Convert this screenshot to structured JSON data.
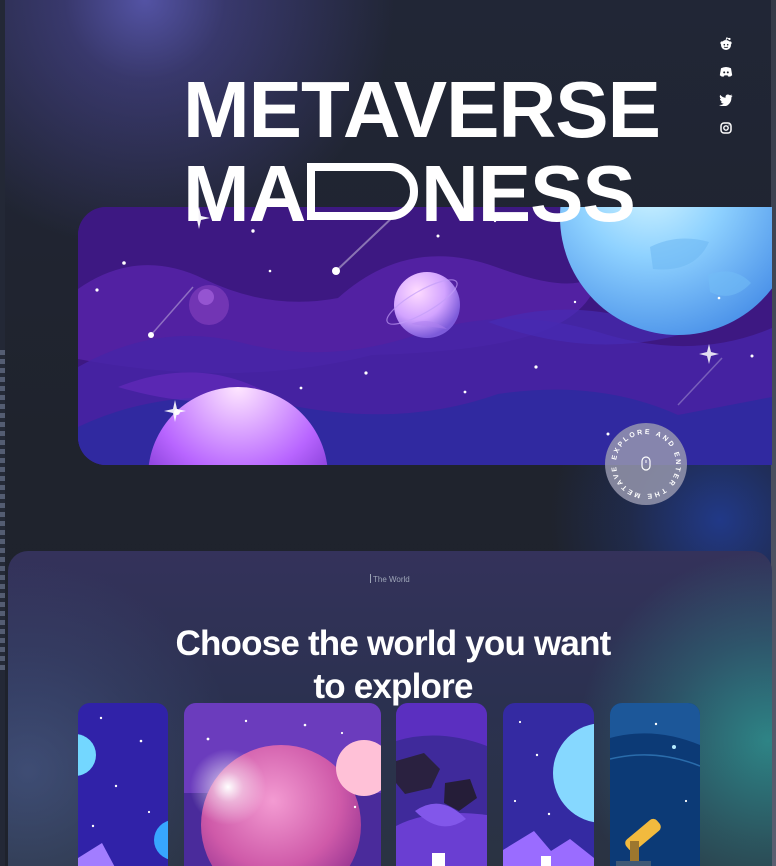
{
  "social": {
    "reddit": "reddit-icon",
    "discord": "discord-icon",
    "twitter": "twitter-icon",
    "instagram": "instagram-icon"
  },
  "hero": {
    "title_line1": "METAVERSE",
    "title_line2_before": "MA",
    "title_line2_after": "NESS",
    "badge_text": "EXPLORE AND ENTER THE METAVERSE"
  },
  "worlds": {
    "label": "The World",
    "heading_line1": "Choose the world you want",
    "heading_line2": "to explore",
    "cards": [
      {
        "name": "world-card-1"
      },
      {
        "name": "world-card-2"
      },
      {
        "name": "world-card-3"
      },
      {
        "name": "world-card-4"
      },
      {
        "name": "world-card-5"
      }
    ]
  }
}
